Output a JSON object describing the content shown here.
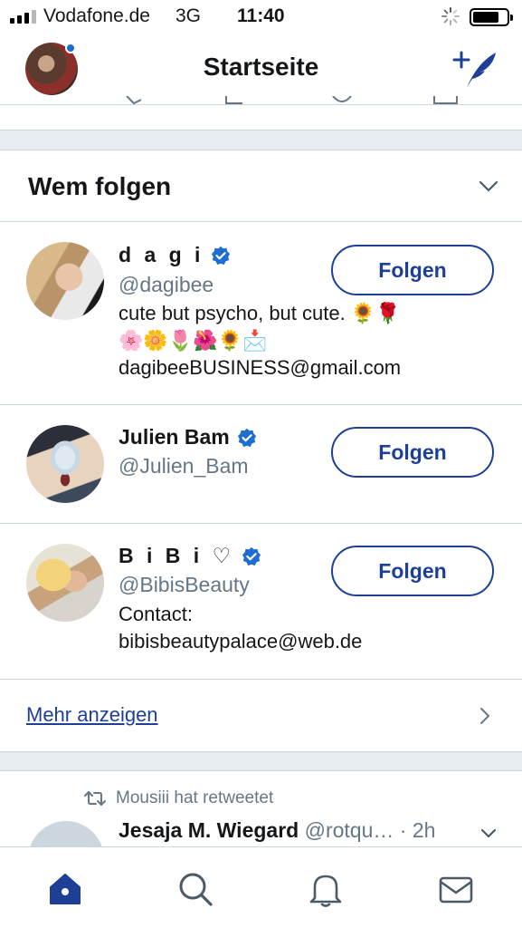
{
  "status_bar": {
    "carrier": "Vodafone.de",
    "network": "3G",
    "time": "11:40"
  },
  "header": {
    "title": "Startseite",
    "avatar": "profile-avatar",
    "compose_icon": "compose-tweet-icon"
  },
  "who_to_follow": {
    "title": "Wem folgen",
    "users": [
      {
        "name": "d a g i",
        "handle": "@dagibee",
        "verified": true,
        "bio_line1": "cute but psycho, but cute. 🌻🌹",
        "bio_line2": "🌸🌼🌷🌺🌻📩",
        "bio_line3": "dagibeeBUSINESS@gmail.com",
        "button": "Folgen"
      },
      {
        "name": "Julien Bam",
        "handle": "@Julien_Bam",
        "verified": true,
        "button": "Folgen"
      },
      {
        "name": "B i B i ♡",
        "handle": "@BibisBeauty",
        "verified": true,
        "bio_line1": "Contact:",
        "bio_line2": "bibisbeautypalace@web.de",
        "button": "Folgen"
      }
    ],
    "more_label": "Mehr anzeigen"
  },
  "tweet": {
    "retweet_label": "Mousiii hat retweetet",
    "author_name": "Jesaja M. Wiegard",
    "author_handle": "@rotqu…",
    "time": "· 2h"
  },
  "tabs": [
    "home-icon",
    "search-icon",
    "notifications-icon",
    "messages-icon"
  ],
  "colors": {
    "accent": "#1e3f96",
    "verified": "#1d6ecf",
    "secondary_text": "#657786",
    "divider": "#ccd6dd",
    "section_gap": "#e6ecf0"
  }
}
